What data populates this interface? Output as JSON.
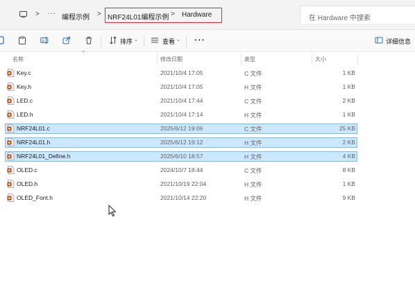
{
  "address_bar": {
    "more_glyph": "···",
    "separator": ">",
    "breadcrumbs": [
      "编程示例",
      "NRF24L01编程示例",
      "Hardware"
    ],
    "search_placeholder": "在 Hardware 中搜索"
  },
  "toolbar": {
    "sort_label": "排序",
    "view_label": "查看",
    "more_label": "···",
    "details_label": "详细信息"
  },
  "columns": {
    "name": "名称",
    "date": "修改日期",
    "type": "类型",
    "size": "大小"
  },
  "files": [
    {
      "name": "Key.c",
      "date": "2021/10/4 17:05",
      "type": "C 文件",
      "size": "1 KB",
      "selected": false
    },
    {
      "name": "Key.h",
      "date": "2021/10/4 17:05",
      "type": "H 文件",
      "size": "1 KB",
      "selected": false
    },
    {
      "name": "LED.c",
      "date": "2021/10/4 17:44",
      "type": "C 文件",
      "size": "2 KB",
      "selected": false
    },
    {
      "name": "LED.h",
      "date": "2021/10/4 17:14",
      "type": "H 文件",
      "size": "1 KB",
      "selected": false
    },
    {
      "name": "NRF24L01.c",
      "date": "2025/6/12 19:06",
      "type": "C 文件",
      "size": "25 KB",
      "selected": true
    },
    {
      "name": "NRF24L01.h",
      "date": "2025/6/12 19:12",
      "type": "H 文件",
      "size": "2 KB",
      "selected": true
    },
    {
      "name": "NRF24L01_Define.h",
      "date": "2025/6/10 18:57",
      "type": "H 文件",
      "size": "4 KB",
      "selected": true
    },
    {
      "name": "OLED.c",
      "date": "2024/10/7 18:44",
      "type": "C 文件",
      "size": "8 KB",
      "selected": false
    },
    {
      "name": "OLED.h",
      "date": "2021/10/19 22:04",
      "type": "H 文件",
      "size": "1 KB",
      "selected": false
    },
    {
      "name": "OLED_Font.h",
      "date": "2021/10/14 22:20",
      "type": "H 文件",
      "size": "9 KB",
      "selected": false
    }
  ],
  "colors": {
    "selection_fill": "#cce8ff",
    "selection_border": "#8cb8df",
    "highlight_box": "#e0262c",
    "file_icon": "#c0392b"
  },
  "icons": {
    "monitor": "monitor-icon",
    "new": "new-item-icon",
    "clipboard": "clipboard-icon",
    "rename": "rename-icon",
    "share": "share-icon",
    "delete": "trash-icon",
    "sort": "sort-icon",
    "view": "view-icon",
    "details": "details-pane-icon",
    "file": "source-file-icon"
  }
}
